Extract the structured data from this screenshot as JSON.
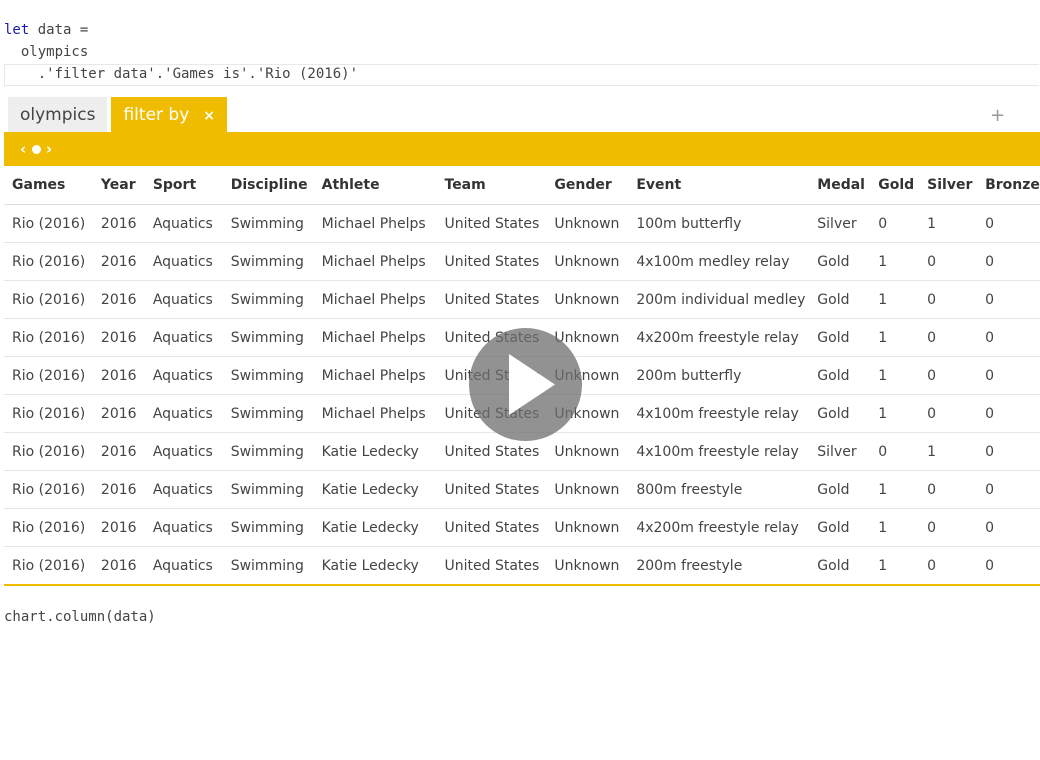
{
  "code": {
    "keyword": "let",
    "line1_rest": " data =",
    "line2": "  olympics",
    "line3": "    .'filter data'.'Games is'.'Rio (2016)'",
    "chart_call": "chart.column(data)"
  },
  "tabs": {
    "source": "olympics",
    "active": "filter by",
    "close": "×",
    "add": "+"
  },
  "nav": {
    "prev": "‹",
    "next": "›"
  },
  "table": {
    "columns": [
      "Games",
      "Year",
      "Sport",
      "Discipline",
      "Athlete",
      "Team",
      "Gender",
      "Event",
      "Medal",
      "Gold",
      "Silver",
      "Bronze"
    ],
    "rows": [
      [
        "Rio (2016)",
        "2016",
        "Aquatics",
        "Swimming",
        "Michael Phelps",
        "United States",
        "Unknown",
        "100m butterfly",
        "Silver",
        "0",
        "1",
        "0"
      ],
      [
        "Rio (2016)",
        "2016",
        "Aquatics",
        "Swimming",
        "Michael Phelps",
        "United States",
        "Unknown",
        "4x100m medley relay",
        "Gold",
        "1",
        "0",
        "0"
      ],
      [
        "Rio (2016)",
        "2016",
        "Aquatics",
        "Swimming",
        "Michael Phelps",
        "United States",
        "Unknown",
        "200m individual medley",
        "Gold",
        "1",
        "0",
        "0"
      ],
      [
        "Rio (2016)",
        "2016",
        "Aquatics",
        "Swimming",
        "Michael Phelps",
        "United States",
        "Unknown",
        "4x200m freestyle relay",
        "Gold",
        "1",
        "0",
        "0"
      ],
      [
        "Rio (2016)",
        "2016",
        "Aquatics",
        "Swimming",
        "Michael Phelps",
        "United States",
        "Unknown",
        "200m butterfly",
        "Gold",
        "1",
        "0",
        "0"
      ],
      [
        "Rio (2016)",
        "2016",
        "Aquatics",
        "Swimming",
        "Michael Phelps",
        "United States",
        "Unknown",
        "4x100m freestyle relay",
        "Gold",
        "1",
        "0",
        "0"
      ],
      [
        "Rio (2016)",
        "2016",
        "Aquatics",
        "Swimming",
        "Katie Ledecky",
        "United States",
        "Unknown",
        "4x100m freestyle relay",
        "Silver",
        "0",
        "1",
        "0"
      ],
      [
        "Rio (2016)",
        "2016",
        "Aquatics",
        "Swimming",
        "Katie Ledecky",
        "United States",
        "Unknown",
        "800m freestyle",
        "Gold",
        "1",
        "0",
        "0"
      ],
      [
        "Rio (2016)",
        "2016",
        "Aquatics",
        "Swimming",
        "Katie Ledecky",
        "United States",
        "Unknown",
        "4x200m freestyle relay",
        "Gold",
        "1",
        "0",
        "0"
      ],
      [
        "Rio (2016)",
        "2016",
        "Aquatics",
        "Swimming",
        "Katie Ledecky",
        "United States",
        "Unknown",
        "200m freestyle",
        "Gold",
        "1",
        "0",
        "0"
      ]
    ]
  },
  "overlay": {
    "icon": "play-icon"
  },
  "colors": {
    "accent": "#f0bc00",
    "keyword": "#1a1aa6"
  }
}
